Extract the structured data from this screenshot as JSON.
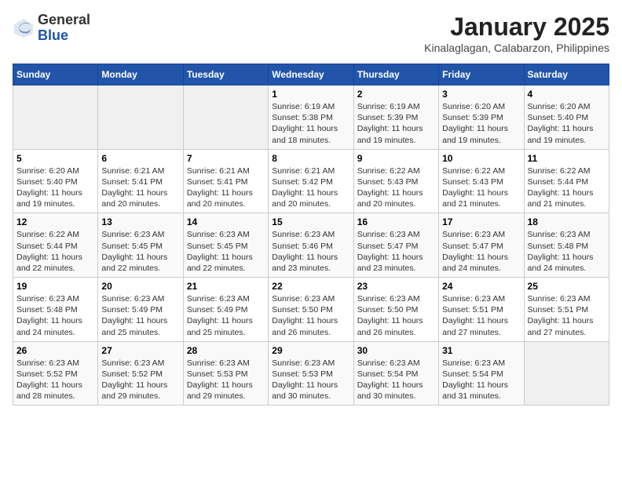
{
  "header": {
    "logo_general": "General",
    "logo_blue": "Blue",
    "month": "January 2025",
    "location": "Kinalaglagan, Calabarzon, Philippines"
  },
  "weekdays": [
    "Sunday",
    "Monday",
    "Tuesday",
    "Wednesday",
    "Thursday",
    "Friday",
    "Saturday"
  ],
  "weeks": [
    [
      {
        "day": "",
        "empty": true
      },
      {
        "day": "",
        "empty": true
      },
      {
        "day": "",
        "empty": true
      },
      {
        "day": "1",
        "sunrise": "6:19 AM",
        "sunset": "5:38 PM",
        "daylight": "11 hours and 18 minutes."
      },
      {
        "day": "2",
        "sunrise": "6:19 AM",
        "sunset": "5:39 PM",
        "daylight": "11 hours and 19 minutes."
      },
      {
        "day": "3",
        "sunrise": "6:20 AM",
        "sunset": "5:39 PM",
        "daylight": "11 hours and 19 minutes."
      },
      {
        "day": "4",
        "sunrise": "6:20 AM",
        "sunset": "5:40 PM",
        "daylight": "11 hours and 19 minutes."
      }
    ],
    [
      {
        "day": "5",
        "sunrise": "6:20 AM",
        "sunset": "5:40 PM",
        "daylight": "11 hours and 19 minutes."
      },
      {
        "day": "6",
        "sunrise": "6:21 AM",
        "sunset": "5:41 PM",
        "daylight": "11 hours and 20 minutes."
      },
      {
        "day": "7",
        "sunrise": "6:21 AM",
        "sunset": "5:41 PM",
        "daylight": "11 hours and 20 minutes."
      },
      {
        "day": "8",
        "sunrise": "6:21 AM",
        "sunset": "5:42 PM",
        "daylight": "11 hours and 20 minutes."
      },
      {
        "day": "9",
        "sunrise": "6:22 AM",
        "sunset": "5:43 PM",
        "daylight": "11 hours and 20 minutes."
      },
      {
        "day": "10",
        "sunrise": "6:22 AM",
        "sunset": "5:43 PM",
        "daylight": "11 hours and 21 minutes."
      },
      {
        "day": "11",
        "sunrise": "6:22 AM",
        "sunset": "5:44 PM",
        "daylight": "11 hours and 21 minutes."
      }
    ],
    [
      {
        "day": "12",
        "sunrise": "6:22 AM",
        "sunset": "5:44 PM",
        "daylight": "11 hours and 22 minutes."
      },
      {
        "day": "13",
        "sunrise": "6:23 AM",
        "sunset": "5:45 PM",
        "daylight": "11 hours and 22 minutes."
      },
      {
        "day": "14",
        "sunrise": "6:23 AM",
        "sunset": "5:45 PM",
        "daylight": "11 hours and 22 minutes."
      },
      {
        "day": "15",
        "sunrise": "6:23 AM",
        "sunset": "5:46 PM",
        "daylight": "11 hours and 23 minutes."
      },
      {
        "day": "16",
        "sunrise": "6:23 AM",
        "sunset": "5:47 PM",
        "daylight": "11 hours and 23 minutes."
      },
      {
        "day": "17",
        "sunrise": "6:23 AM",
        "sunset": "5:47 PM",
        "daylight": "11 hours and 24 minutes."
      },
      {
        "day": "18",
        "sunrise": "6:23 AM",
        "sunset": "5:48 PM",
        "daylight": "11 hours and 24 minutes."
      }
    ],
    [
      {
        "day": "19",
        "sunrise": "6:23 AM",
        "sunset": "5:48 PM",
        "daylight": "11 hours and 24 minutes."
      },
      {
        "day": "20",
        "sunrise": "6:23 AM",
        "sunset": "5:49 PM",
        "daylight": "11 hours and 25 minutes."
      },
      {
        "day": "21",
        "sunrise": "6:23 AM",
        "sunset": "5:49 PM",
        "daylight": "11 hours and 25 minutes."
      },
      {
        "day": "22",
        "sunrise": "6:23 AM",
        "sunset": "5:50 PM",
        "daylight": "11 hours and 26 minutes."
      },
      {
        "day": "23",
        "sunrise": "6:23 AM",
        "sunset": "5:50 PM",
        "daylight": "11 hours and 26 minutes."
      },
      {
        "day": "24",
        "sunrise": "6:23 AM",
        "sunset": "5:51 PM",
        "daylight": "11 hours and 27 minutes."
      },
      {
        "day": "25",
        "sunrise": "6:23 AM",
        "sunset": "5:51 PM",
        "daylight": "11 hours and 27 minutes."
      }
    ],
    [
      {
        "day": "26",
        "sunrise": "6:23 AM",
        "sunset": "5:52 PM",
        "daylight": "11 hours and 28 minutes."
      },
      {
        "day": "27",
        "sunrise": "6:23 AM",
        "sunset": "5:52 PM",
        "daylight": "11 hours and 29 minutes."
      },
      {
        "day": "28",
        "sunrise": "6:23 AM",
        "sunset": "5:53 PM",
        "daylight": "11 hours and 29 minutes."
      },
      {
        "day": "29",
        "sunrise": "6:23 AM",
        "sunset": "5:53 PM",
        "daylight": "11 hours and 30 minutes."
      },
      {
        "day": "30",
        "sunrise": "6:23 AM",
        "sunset": "5:54 PM",
        "daylight": "11 hours and 30 minutes."
      },
      {
        "day": "31",
        "sunrise": "6:23 AM",
        "sunset": "5:54 PM",
        "daylight": "11 hours and 31 minutes."
      },
      {
        "day": "",
        "empty": true
      }
    ]
  ],
  "labels": {
    "sunrise": "Sunrise:",
    "sunset": "Sunset:",
    "daylight": "Daylight hours"
  }
}
